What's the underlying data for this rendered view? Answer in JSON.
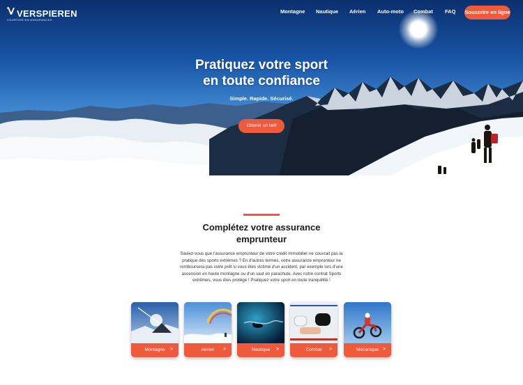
{
  "brand": {
    "name": "VERSPIEREN",
    "tagline": "COURTIER EN ASSURANCES"
  },
  "nav": {
    "items": [
      {
        "label": "Montagne"
      },
      {
        "label": "Nautique"
      },
      {
        "label": "Aérien"
      },
      {
        "label": "Auto-moto"
      },
      {
        "label": "Combat"
      },
      {
        "label": "FAQ"
      }
    ],
    "cta_label": "Souscrire en ligne"
  },
  "hero": {
    "title_line1": "Pratiquez votre sport",
    "title_line2": "en toute confiance",
    "subtitle": "Simple. Rapide. Sécurisé.",
    "button_label": "Obtenir un tarif"
  },
  "section": {
    "title_line1": "Complétez votre assurance",
    "title_line2": "emprunteur",
    "body": "Saviez-vous que l'assurance emprunteur de votre crédit immobilier ne couvrait pas la pratique des sports extrêmes ? En d'autres termes, votre assurance emprunteur ne remboursera pas votre prêt si vous êtes victime d'un accident, par exemple lors d'une ascension en haute montagne ou d'un saut en parachute. Avec notre contrat Sports extrêmes, vous êtes protégé ! Pratiquez votre sport en toute tranquillité !"
  },
  "cards": [
    {
      "label": "Montagne",
      "arrow": ">"
    },
    {
      "label": "Aérien",
      "arrow": ">"
    },
    {
      "label": "Nautique",
      "arrow": ">"
    },
    {
      "label": "Combat",
      "arrow": ">"
    },
    {
      "label": "Mécanique",
      "arrow": ">"
    }
  ],
  "colors": {
    "accent": "#ef5a3c",
    "sky_dark": "#0a2f6e",
    "text_dark": "#1a1a1a"
  }
}
